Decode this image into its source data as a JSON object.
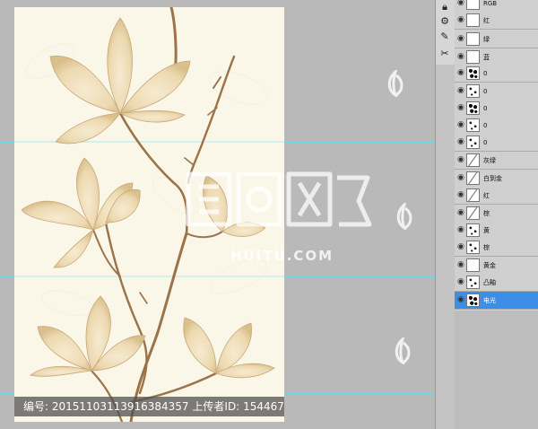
{
  "caption": {
    "id_label": "编号:",
    "id_value": "20151103113916384357",
    "uploader_label": "上传者ID:",
    "uploader_value": "154467"
  },
  "watermark": {
    "site": "HUITU.COM"
  },
  "toolbar": {
    "icons": [
      "lock-icon",
      "layer-style-icon",
      "script-icon",
      "scissors-icon"
    ]
  },
  "layers": [
    {
      "name": "RGB",
      "thumb": "white",
      "selected": false
    },
    {
      "name": "红",
      "thumb": "white",
      "selected": false
    },
    {
      "name": "绿",
      "thumb": "white",
      "selected": false
    },
    {
      "name": "蓝",
      "thumb": "white",
      "selected": false
    },
    {
      "name": "0",
      "thumb": "heavy",
      "selected": false
    },
    {
      "name": "0",
      "thumb": "dots",
      "selected": false
    },
    {
      "name": "0",
      "thumb": "heavy",
      "selected": false
    },
    {
      "name": "0",
      "thumb": "dots",
      "selected": false
    },
    {
      "name": "0",
      "thumb": "dots",
      "selected": false
    },
    {
      "name": "灰绿",
      "thumb": "line",
      "selected": false
    },
    {
      "name": "白到金",
      "thumb": "line",
      "selected": false
    },
    {
      "name": "红",
      "thumb": "line",
      "selected": false
    },
    {
      "name": "棕",
      "thumb": "line",
      "selected": false
    },
    {
      "name": "黄",
      "thumb": "dots",
      "selected": false
    },
    {
      "name": "棕",
      "thumb": "dots",
      "selected": false
    },
    {
      "name": "黄金",
      "thumb": "white",
      "selected": false
    },
    {
      "name": "凸釉",
      "thumb": "dots",
      "selected": false
    },
    {
      "name": "电光",
      "thumb": "heavy",
      "selected": true
    }
  ],
  "colors": {
    "canvas_bg": "#b9b9b9",
    "artwork_bg": "#fbf7e8",
    "selected_layer": "#3d8ee6",
    "guide": "#6fd6e6"
  }
}
